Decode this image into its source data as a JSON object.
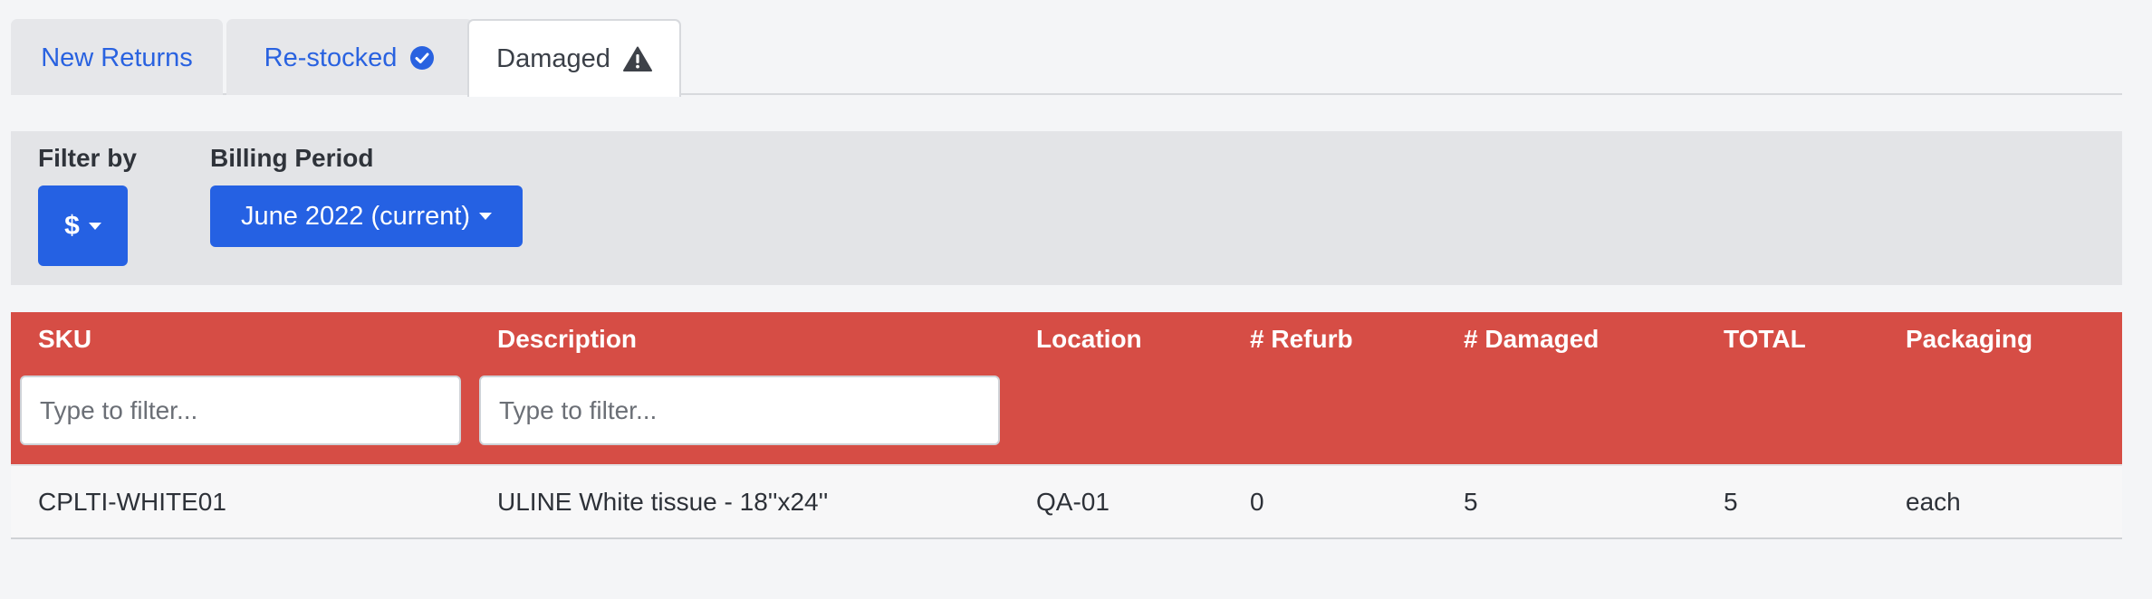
{
  "tabs": [
    {
      "label": "New Returns",
      "icon": ""
    },
    {
      "label": "Re-stocked",
      "icon": "check-circle-icon"
    },
    {
      "label": "Damaged",
      "icon": "warning-triangle-icon"
    }
  ],
  "colors": {
    "primary": "#2561e3",
    "header_red": "#d64d45",
    "panel_gray": "#e3e4e7"
  },
  "filters": {
    "filter_by_label": "Filter by",
    "currency_button": "$",
    "billing_period_label": "Billing Period",
    "billing_period_value": "June 2022 (current)"
  },
  "table": {
    "columns": [
      "SKU",
      "Description",
      "Location",
      "# Refurb",
      "# Damaged",
      "TOTAL",
      "Packaging"
    ],
    "filter_placeholder": "Type to filter...",
    "rows": [
      [
        "CPLTI-WHITE01",
        "ULINE White tissue - 18''x24''",
        "QA-01",
        "0",
        "5",
        "5",
        "each"
      ]
    ]
  }
}
